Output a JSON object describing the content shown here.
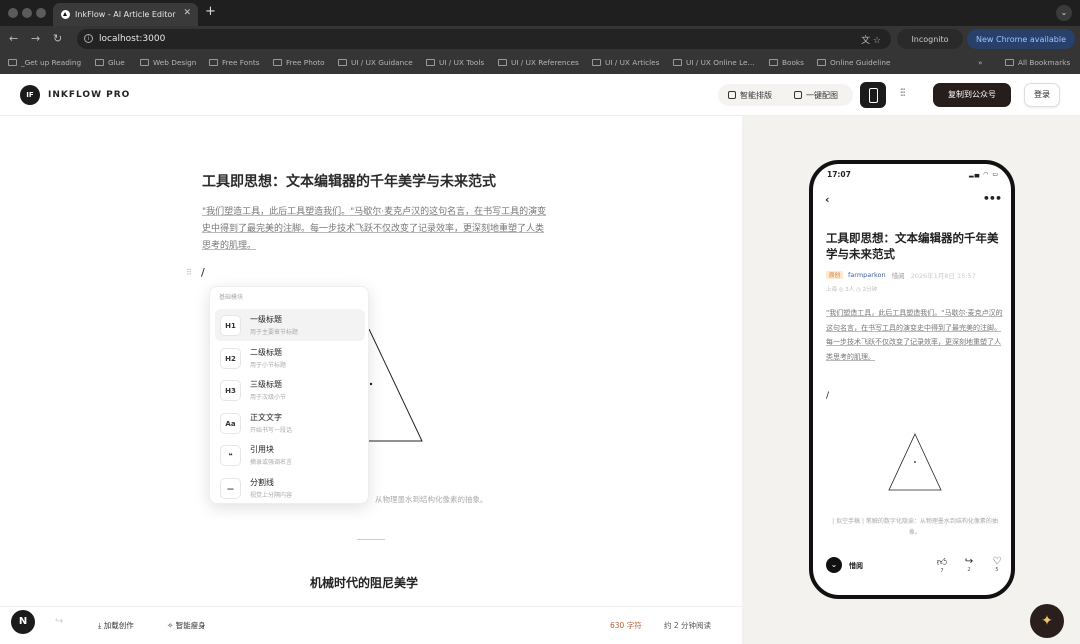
{
  "browser": {
    "tab_title": "InkFlow - AI Article Editor",
    "new_tab": "+",
    "url": "localhost:3000",
    "incognito": "Incognito",
    "update": "New Chrome available",
    "bookmarks": [
      "_Get up Reading",
      "Glue",
      "Web Design",
      "Free Fonts",
      "Free Photo",
      "UI / UX Guidance",
      "UI / UX Tools",
      "UI / UX References",
      "UI / UX Articles",
      "UI / UX Online Le...",
      "Books",
      "Online Guideline"
    ],
    "bookmarks_more": "»",
    "all_bookmarks": "All Bookmarks"
  },
  "header": {
    "logo": "IF",
    "brand": "INKFLOW PRO",
    "smart_layout": "智能排版",
    "one_click_image": "一键配图",
    "copy_button": "复制到公众号",
    "login_button": "登录"
  },
  "editor": {
    "title": "工具即思想：文本编辑器的千年美学与未来范式",
    "quote": "\"我们塑造工具，此后工具塑造我们。\"马歇尔·麦克卢汉的这句名言，在书写工具的演变史中得到了最完美的注脚。每一步技术飞跃不仅改变了记录效率，更深刻地重塑了人类思考的肌理。",
    "slash": "/",
    "caption": "从物理墨水到结构化像素的抽象。",
    "heading2": "机械时代的阻尼美学"
  },
  "menu": {
    "header": "基础模块",
    "items": [
      {
        "icon": "H1",
        "title": "一级标题",
        "sub": "用于主要章节标题"
      },
      {
        "icon": "H2",
        "title": "二级标题",
        "sub": "用于小节标题"
      },
      {
        "icon": "H3",
        "title": "三级标题",
        "sub": "用于次级小节"
      },
      {
        "icon": "Aa",
        "title": "正文文字",
        "sub": "开始书写一段话"
      },
      {
        "icon": "❝",
        "title": "引用块",
        "sub": "摘录或强调名言"
      },
      {
        "icon": "—",
        "title": "分割线",
        "sub": "视觉上分隔内容"
      }
    ]
  },
  "bottom": {
    "n": "N",
    "add_creation": "加载创作",
    "smart_slim": "智能瘦身",
    "word_count": "630 字符",
    "read_time": "约 2 分钟阅读"
  },
  "preview": {
    "time": "17:07",
    "title": "工具即思想：文本编辑器的千年美学与未来范式",
    "badge": "原创",
    "author": "farmparkon",
    "account": "惜阅",
    "date": "2026年1月8日 15:57",
    "stats": "上海  ◎ 3人  ◷ 2分钟",
    "quote": "\"我们塑造工具，此后工具塑造我们。\"马歇尔·麦克卢汉的这句名言，在书写工具的演变史中得到了最完美的注脚。每一步技术飞跃不仅改变了记录效率，更深刻地重塑了人类思考的肌理。",
    "slash": "/",
    "caption": "| 拟空手稿 | 笔触的数字化隐谕：从物理墨水到结构化像素的抽象。",
    "foot_name": "惜阅",
    "likes": "7",
    "shares": "2",
    "hearts": "5"
  },
  "colors": {
    "accent": "#261e1b",
    "word_count": "#b5613a",
    "update_bg": "#28406a"
  }
}
